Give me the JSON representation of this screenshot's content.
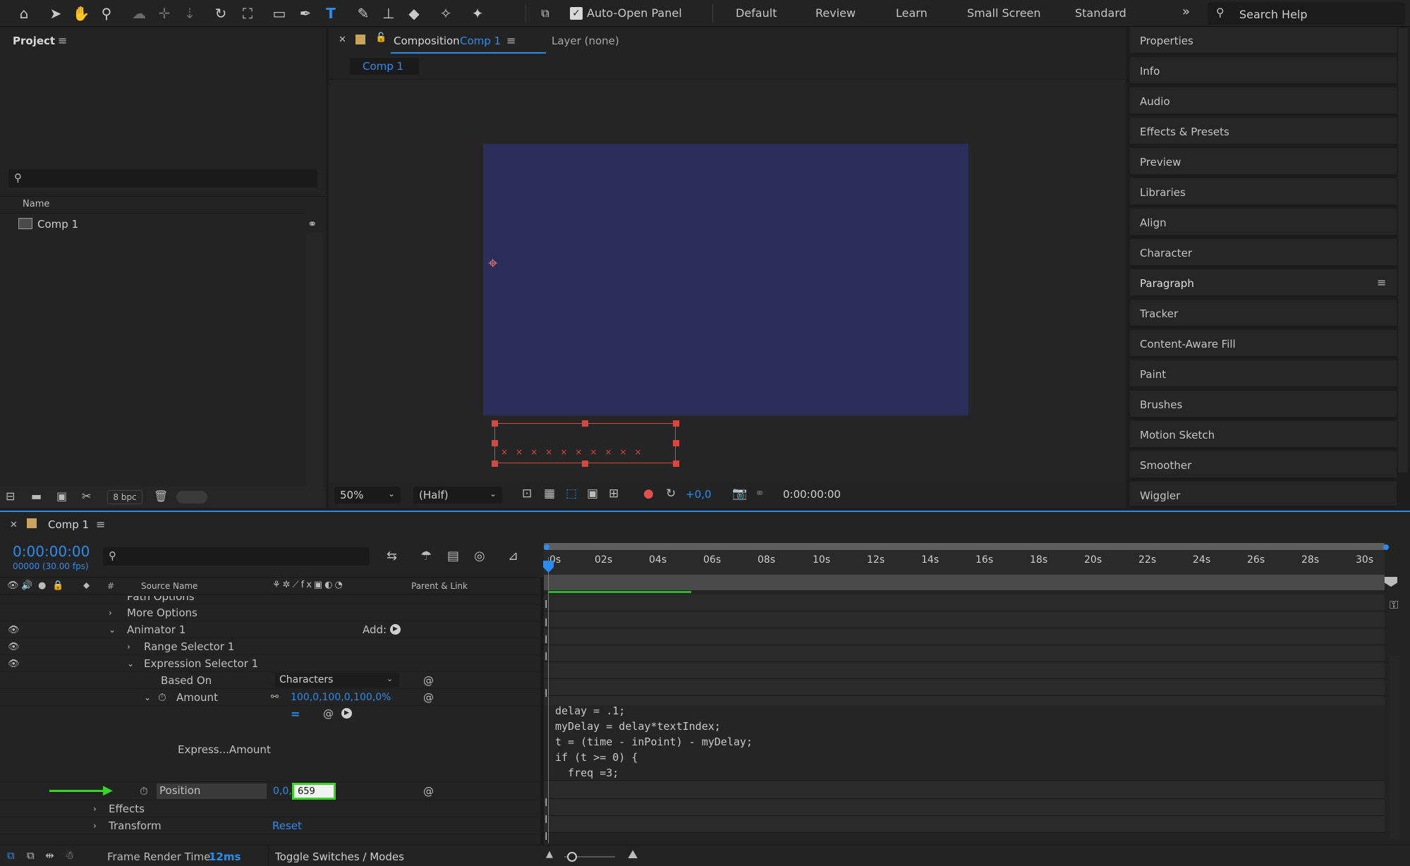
{
  "toolbar": {
    "tools": [
      "home-icon",
      "selection-arrow-icon",
      "hand-icon",
      "zoom-icon",
      "orbit-camera-icon",
      "pan-camera-icon",
      "dolly-camera-icon",
      "rotate-icon",
      "pan-behind-icon",
      "rectangle-icon",
      "pen-icon",
      "type-icon",
      "brush-icon",
      "clone-stamp-icon",
      "eraser-icon",
      "roto-brush-icon",
      "puppet-pin-icon"
    ],
    "auto_open_panel_label": "Auto-Open Panel",
    "workspaces": [
      "Default",
      "Review",
      "Learn",
      "Small Screen",
      "Standard"
    ],
    "search_placeholder": "Search Help"
  },
  "project": {
    "title": "Project",
    "column_name": "Name",
    "items": [
      {
        "name": "Comp 1"
      }
    ],
    "bpc": "8 bpc"
  },
  "composition": {
    "tab_prefix": "Composition",
    "tab_name": "Comp 1",
    "layer_tab": "Layer (none)",
    "breadcrumb": "Comp 1",
    "zoom": "50%",
    "resolution": "(Half)",
    "exposure": "+0,0",
    "timecode": "0:00:00:00",
    "canvas_color": "#2b2e58"
  },
  "right_panels": [
    "Properties",
    "Info",
    "Audio",
    "Effects & Presets",
    "Preview",
    "Libraries",
    "Align",
    "Character",
    "Paragraph",
    "Tracker",
    "Content-Aware Fill",
    "Paint",
    "Brushes",
    "Motion Sketch",
    "Smoother",
    "Wiggler"
  ],
  "timeline": {
    "comp_tab": "Comp 1",
    "timecode": "0:00:00:00",
    "frames": "00000 (30.00 fps)",
    "columns": {
      "hash": "#",
      "source_name": "Source Name",
      "parent_link": "Parent & Link"
    },
    "ruler": [
      "0s",
      "02s",
      "04s",
      "06s",
      "08s",
      "10s",
      "12s",
      "14s",
      "16s",
      "18s",
      "20s",
      "22s",
      "24s",
      "26s",
      "28s",
      "30s"
    ],
    "rows": {
      "path_options": "Path Options",
      "more_options": "More Options",
      "animator": "Animator 1",
      "add_label": "Add:",
      "range_selector": "Range Selector 1",
      "expression_selector": "Expression Selector 1",
      "based_on_label": "Based On",
      "based_on_value": "Characters",
      "amount_label": "Amount",
      "amount_value": "100,0,100,0,100,0%",
      "expression_label": "Express...Amount",
      "position_label": "Position",
      "position_prefix": "0,0,",
      "position_input": "659",
      "effects": "Effects",
      "transform": "Transform",
      "reset": "Reset"
    },
    "expression_code": [
      "delay = .1;",
      "myDelay = delay*textIndex;",
      "t = (time - inPoint) - myDelay;",
      "if (t >= 0) {",
      "  freq =3;"
    ],
    "frame_render_label": "Frame Render Time",
    "frame_render_value": "12ms",
    "toggle_label": "Toggle Switches / Modes"
  },
  "colors": {
    "accent": "#2d8ceb",
    "highlight": "#39d42a",
    "handle": "#d9463f"
  }
}
